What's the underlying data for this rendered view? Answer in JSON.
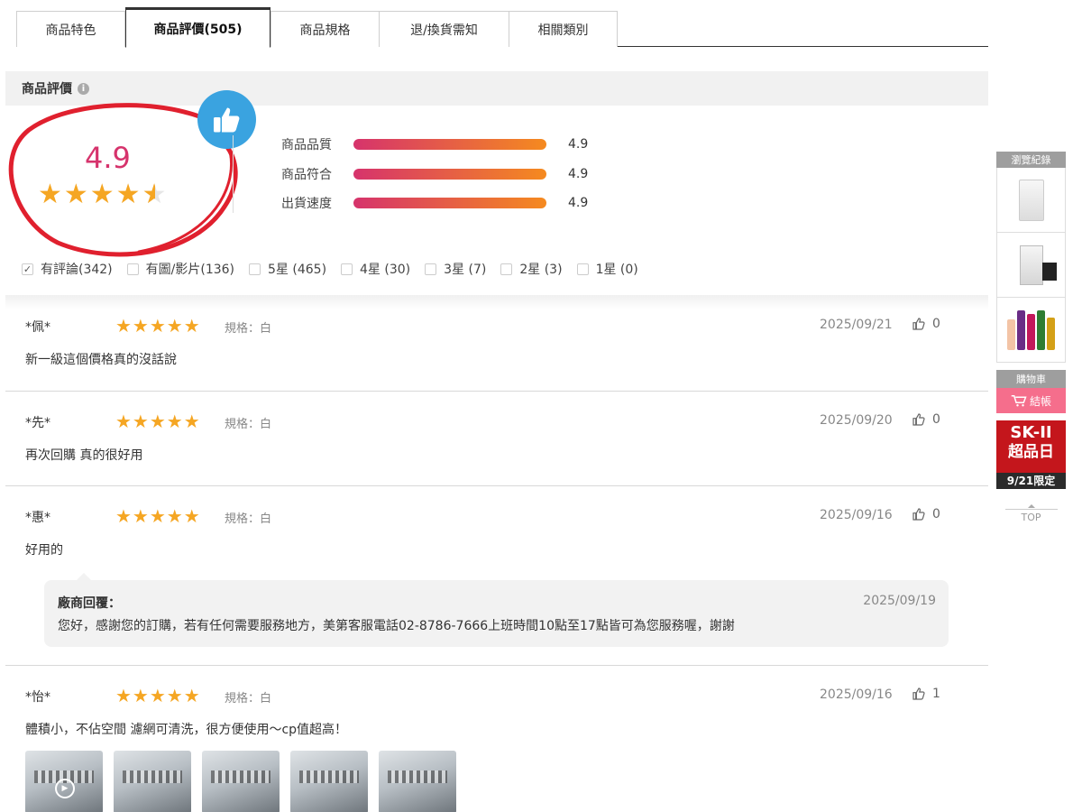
{
  "tabs": [
    {
      "label": "商品特色"
    },
    {
      "label": "商品評價(505)"
    },
    {
      "label": "商品規格"
    },
    {
      "label": "退/換貨需知"
    },
    {
      "label": "相關類別"
    }
  ],
  "section_title": "商品評價",
  "overall": {
    "score": "4.9",
    "stars": "★★★★",
    "half_star": "★",
    "rating_value": 4.5
  },
  "sub_ratings": [
    {
      "label": "商品品質",
      "value": "4.9"
    },
    {
      "label": "商品符合",
      "value": "4.9"
    },
    {
      "label": "出貨速度",
      "value": "4.9"
    }
  ],
  "filters": [
    {
      "label": "有評論(342)",
      "checked": true,
      "check_mark": "✓"
    },
    {
      "label": "有圖/影片(136)",
      "checked": false
    },
    {
      "label": "5星 (465)",
      "checked": false
    },
    {
      "label": "4星 (30)",
      "checked": false
    },
    {
      "label": "3星 (7)",
      "checked": false
    },
    {
      "label": "2星 (3)",
      "checked": false
    },
    {
      "label": "1星 (0)",
      "checked": false
    }
  ],
  "reviews": [
    {
      "user": "*佩*",
      "stars": "★★★★★",
      "rating": 5,
      "spec": "規格：白",
      "date": "2025/09/21",
      "likes": "0",
      "text": "新一級這個價格真的沒話說"
    },
    {
      "user": "*先*",
      "stars": "★★★★★",
      "rating": 5,
      "spec": "規格：白",
      "date": "2025/09/20",
      "likes": "0",
      "text": "再次回購 真的很好用"
    },
    {
      "user": "*惠*",
      "stars": "★★★★★",
      "rating": 5,
      "spec": "規格：白",
      "date": "2025/09/16",
      "likes": "0",
      "text": "好用的",
      "reply": {
        "title": "廠商回覆：",
        "date": "2025/09/19",
        "text": "您好，感謝您的訂購，若有任何需要服務地方，美第客服電話02-8786-7666上班時間10點至17點皆可為您服務喔，謝謝"
      }
    },
    {
      "user": "*怡*",
      "stars": "★★★★★",
      "rating": 5,
      "spec": "規格：白",
      "date": "2025/09/16",
      "likes": "1",
      "text": "體積小，不佔空間 濾網可清洗，很方便使用～cp值超高！"
    }
  ],
  "sidebar": {
    "history_label": "瀏覽紀錄",
    "cart_label": "購物車",
    "checkout_label": "結帳",
    "ad": {
      "line1": "SK-II",
      "line2": "超品日",
      "line3": "9/21限定"
    },
    "top_label": "TOP"
  },
  "colors": {
    "accent": "#d6336c",
    "star": "#f5a623",
    "bar_start": "#d6336c",
    "bar_end": "#f58a1f",
    "ad_red": "#c4161c"
  },
  "icons": {
    "info": "info-icon",
    "thumbs_up_badge": "thumbs-up-icon",
    "like": "like-icon",
    "play": "play-icon",
    "cart": "cart-icon"
  }
}
